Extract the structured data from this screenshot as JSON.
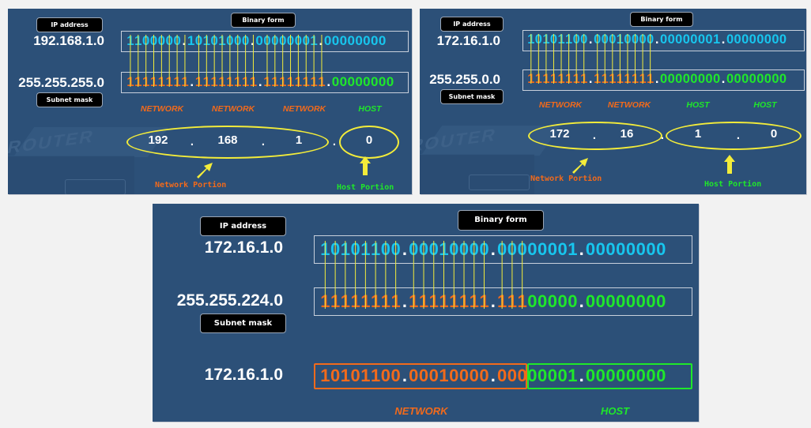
{
  "colors": {
    "background": "#2c5078",
    "ip_binary": "#17c6ee",
    "network": "#f26a1b",
    "host": "#1fe82a",
    "connector_line": "#f3ec3a",
    "badge": "#000000"
  },
  "panels": [
    {
      "id": "p1",
      "badges": {
        "ip_address": "IP address",
        "binary_form": "Binary form",
        "subnet_mask": "Subnet mask"
      },
      "ip_dotted": "192.168.1.0",
      "mask_dotted": "255.255.255.0",
      "ip_binary": [
        "1100000",
        "10101000",
        "00000001",
        "00000000"
      ],
      "mask_binary": [
        "11111111",
        "11111111",
        "11111111",
        "00000000"
      ],
      "ip_binary_role": "ip",
      "mask_roles": [
        "net",
        "net",
        "net",
        "host"
      ],
      "segment_labels": [
        {
          "text": "NETWORK",
          "role": "net"
        },
        {
          "text": "NETWORK",
          "role": "net"
        },
        {
          "text": "NETWORK",
          "role": "net"
        },
        {
          "text": "HOST",
          "role": "host"
        }
      ],
      "octets": [
        "192",
        "168",
        "1",
        "0"
      ],
      "octet_separator": ".",
      "network_portion_label": "Network Portion",
      "host_portion_label": "Host Portion",
      "router_label": "ROUTER"
    },
    {
      "id": "p2",
      "badges": {
        "ip_address": "IP address",
        "binary_form": "Binary form",
        "subnet_mask": "Subnet mask"
      },
      "ip_dotted": "172.16.1.0",
      "mask_dotted": "255.255.0.0",
      "ip_binary": [
        "10101100",
        "00010000",
        "00000001",
        "00000000"
      ],
      "mask_binary": [
        "11111111",
        "11111111",
        "00000000",
        "00000000"
      ],
      "ip_binary_role": "ip",
      "mask_roles": [
        "net",
        "net",
        "host",
        "host"
      ],
      "segment_labels": [
        {
          "text": "NETWORK",
          "role": "net"
        },
        {
          "text": "NETWORK",
          "role": "net"
        },
        {
          "text": "HOST",
          "role": "host"
        },
        {
          "text": "HOST",
          "role": "host"
        }
      ],
      "octets": [
        "172",
        "16",
        "1",
        "0"
      ],
      "octet_separator": ".",
      "network_portion_label": "Network Portion",
      "host_portion_label": "Host Portion",
      "router_label": "ROUTER"
    },
    {
      "id": "p3",
      "badges": {
        "ip_address": "IP address",
        "binary_form": "Binary form",
        "subnet_mask": "Subnet mask"
      },
      "ip_dotted": "172.16.1.0",
      "mask_dotted": "255.255.224.0",
      "ip_binary": [
        "10101100",
        "00010000",
        "00000001",
        "00000000"
      ],
      "mask_binary": [
        "11111111",
        "11111111",
        "11100000",
        "00000000"
      ],
      "ip_binary_role": "ip",
      "mask_prefix_bits": 19,
      "result_dotted": "172.16.1.0",
      "result_binary": [
        "10101100",
        "00010000",
        "00000001",
        "00000000"
      ],
      "result_labels": [
        {
          "text": "NETWORK",
          "role": "net"
        },
        {
          "text": "HOST",
          "role": "host"
        }
      ]
    }
  ]
}
